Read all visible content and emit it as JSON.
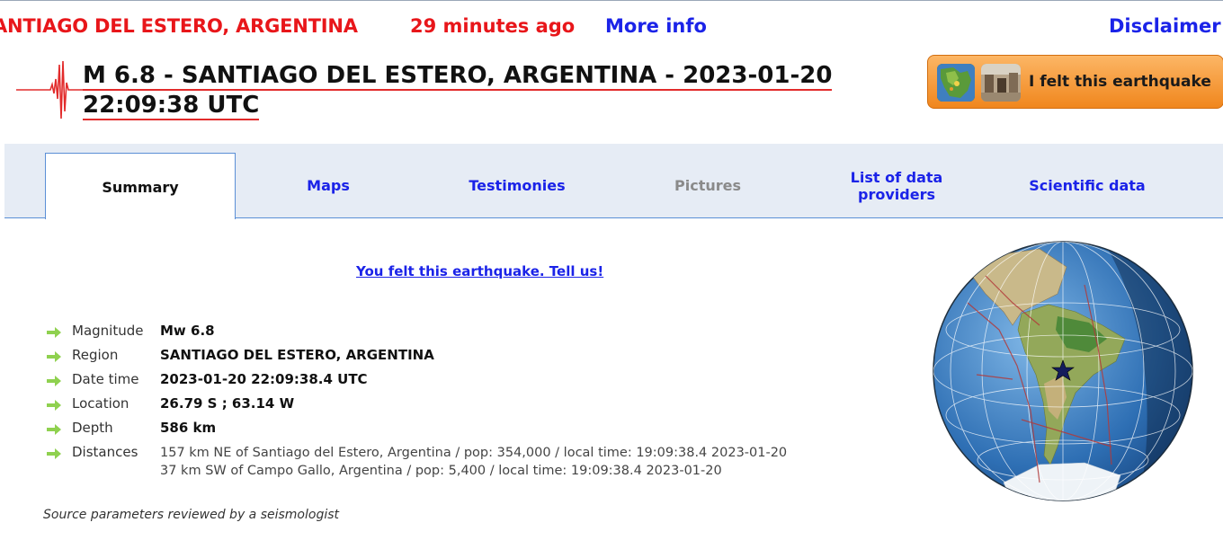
{
  "top_bar": {
    "region": "ANTIAGO DEL ESTERO, ARGENTINA",
    "time_ago": "29 minutes ago",
    "more_info": "More info",
    "disclaimer": "Disclaimer"
  },
  "title": {
    "line1": "M 6.8 - SANTIAGO DEL ESTERO, ARGENTINA - 2023-01-20",
    "line2": "22:09:38 UTC"
  },
  "felt_button": {
    "label": "I felt this earthquake"
  },
  "tabs": [
    {
      "label": "Summary",
      "state": "active"
    },
    {
      "label": "Maps",
      "state": "normal"
    },
    {
      "label": "Testimonies",
      "state": "normal"
    },
    {
      "label": "Pictures",
      "state": "disabled"
    },
    {
      "label": "List of data providers",
      "state": "normal"
    },
    {
      "label": "Scientific data",
      "state": "normal"
    }
  ],
  "tell_us": "You felt this earthquake. Tell us!",
  "details": {
    "magnitude": {
      "label": "Magnitude",
      "value": "Mw 6.8"
    },
    "region": {
      "label": "Region",
      "value": "SANTIAGO DEL ESTERO, ARGENTINA"
    },
    "date_time": {
      "label": "Date time",
      "value": "2023-01-20 22:09:38.4 UTC"
    },
    "location": {
      "label": "Location",
      "value": "26.79 S ; 63.14 W"
    },
    "depth": {
      "label": "Depth",
      "value": "586 km"
    },
    "distances": {
      "label": "Distances",
      "lines": [
        "157 km NE of Santiago del Estero, Argentina / pop: 354,000 / local time: 19:09:38.4 2023-01-20",
        "37 km SW of Campo Gallo, Argentina / pop: 5,400 / local time: 19:09:38.4 2023-01-20"
      ]
    }
  },
  "source_note": "Source parameters reviewed by a seismologist",
  "colors": {
    "alert_red": "#e8161a",
    "link_blue": "#1b23e8",
    "tab_band": "#e6ecf5",
    "arrow_green": "#8fd14f",
    "button_orange": "#f0861d"
  }
}
